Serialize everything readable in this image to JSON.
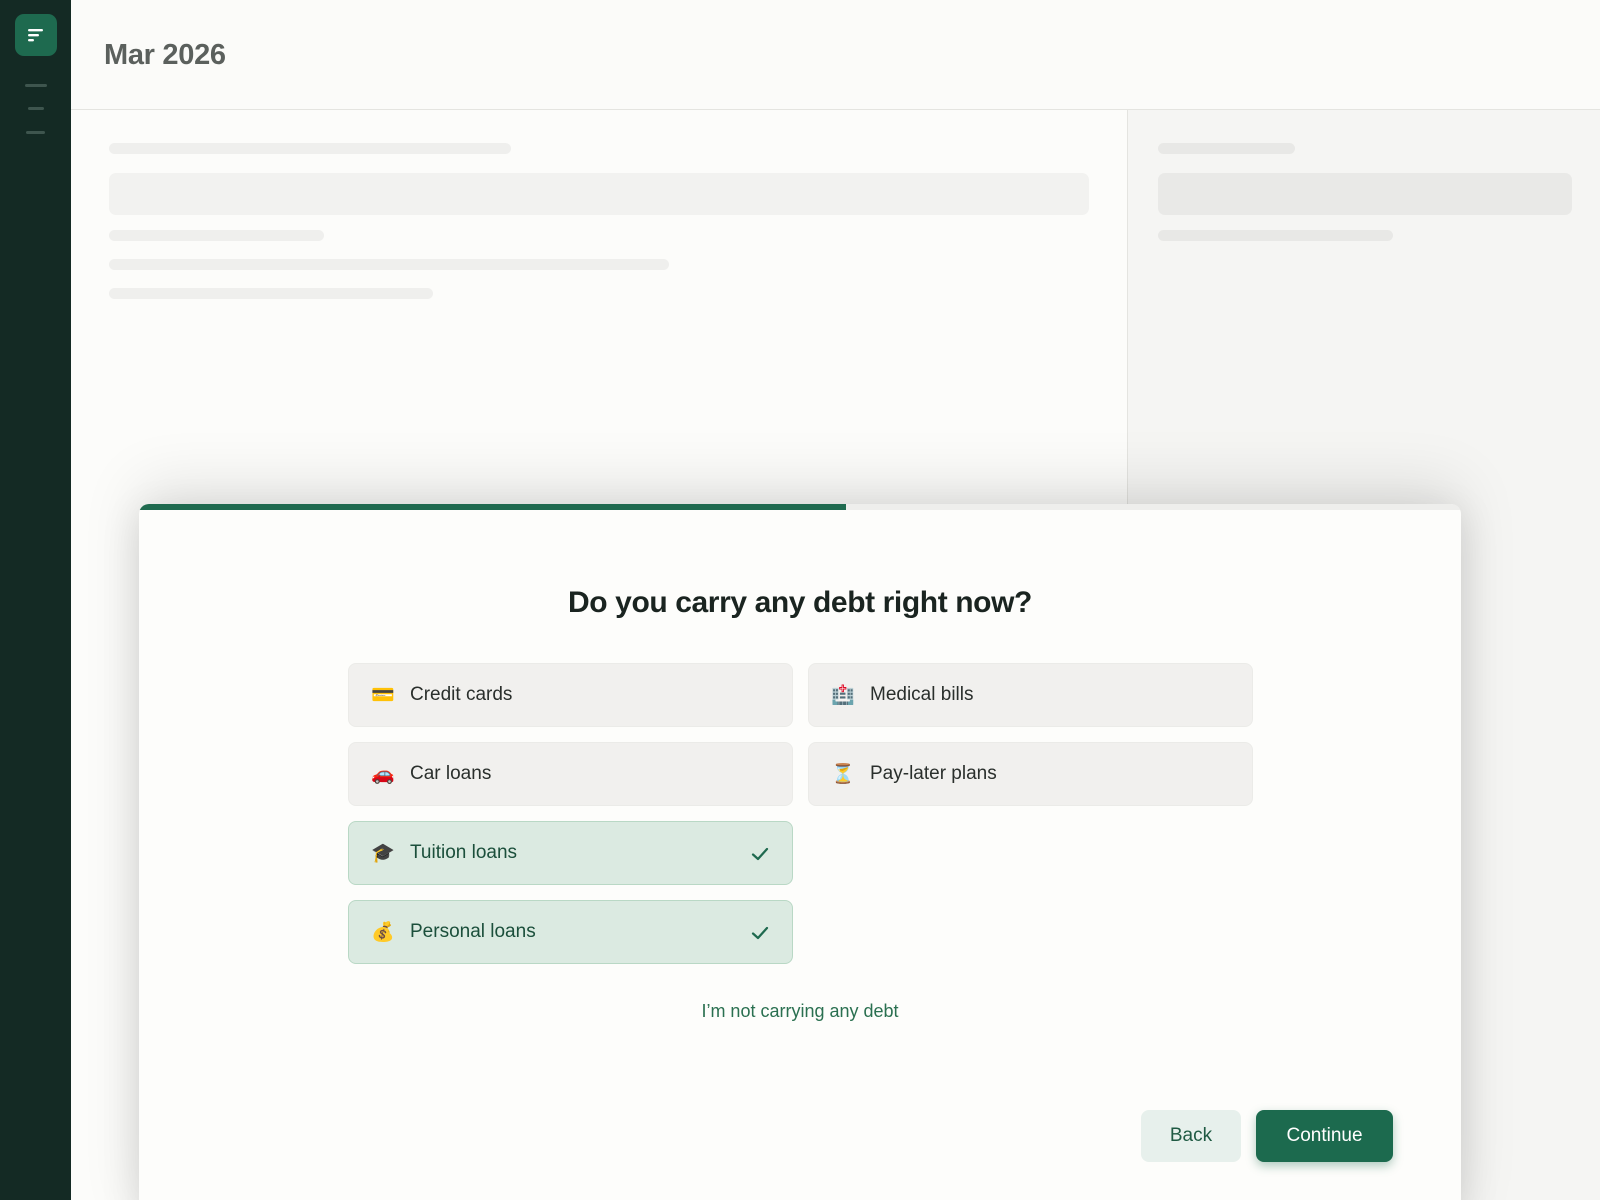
{
  "sidebar": {
    "logo_icon": "menu-lines-icon"
  },
  "header": {
    "month": "Mar 2026"
  },
  "modal": {
    "progress_percent": 53.5,
    "question": "Do you carry any debt right now?",
    "options": [
      {
        "label": "Credit cards",
        "icon": "credit-card-icon",
        "glyph": "💳",
        "selected": false
      },
      {
        "label": "Medical bills",
        "icon": "hospital-icon",
        "glyph": "🏥",
        "selected": false
      },
      {
        "label": "Car loans",
        "icon": "car-icon",
        "glyph": "🚗",
        "selected": false
      },
      {
        "label": "Pay-later plans",
        "icon": "hourglass-icon",
        "glyph": "⏳",
        "selected": false
      },
      {
        "label": "Tuition loans",
        "icon": "graduation-cap-icon",
        "glyph": "🎓",
        "selected": true
      },
      {
        "label": "Personal loans",
        "icon": "money-bag-icon",
        "glyph": "💰",
        "selected": true
      }
    ],
    "no_debt_link": "I’m not carrying any debt",
    "back_label": "Back",
    "continue_label": "Continue"
  },
  "colors": {
    "sidebar": "#142a24",
    "accent": "#1c6a4e",
    "selected_bg": "#dbeae1"
  }
}
